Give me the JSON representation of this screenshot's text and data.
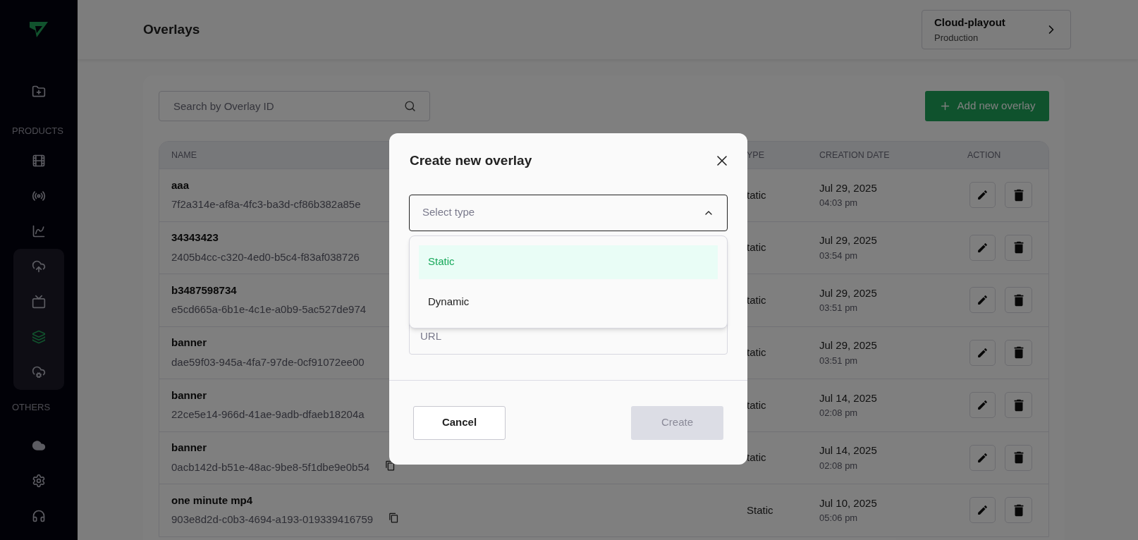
{
  "sidebar": {
    "top_items": [
      {
        "selected": false
      }
    ],
    "sections": [
      {
        "label": "PRODUCTS",
        "items": [
          {
            "selected": false
          },
          {
            "selected": false
          },
          {
            "selected": false
          }
        ],
        "group": [
          {
            "selected": false
          },
          {
            "selected": false
          },
          {
            "selected": true
          },
          {
            "selected": false
          }
        ]
      },
      {
        "label": "OTHERS",
        "items": [
          {
            "selected": false
          },
          {
            "selected": false
          },
          {
            "selected": false
          }
        ]
      }
    ]
  },
  "header": {
    "title": "Overlays",
    "workspace": {
      "name": "Cloud-playout",
      "environment": "Production"
    }
  },
  "toolbar": {
    "search": {
      "placeholder": "Search by Overlay ID"
    },
    "add_button": "Add new overlay"
  },
  "table": {
    "columns": [
      "NAME",
      "YPE",
      "CREATION DATE",
      "ACTION"
    ],
    "rows": [
      {
        "name": "aaa",
        "id": "7f2a314e-af8a-4fc3-ba3d-cf86b382a85e",
        "copyable": false,
        "type": "tatic",
        "date": "Jul 29, 2025",
        "time": "04:03 pm"
      },
      {
        "name": "34343423",
        "id": "2405b4cc-c320-4ed0-b5c4-f83af038726",
        "copyable": false,
        "type": "tatic",
        "date": "Jul 29, 2025",
        "time": "03:54 pm"
      },
      {
        "name": "b3487598734",
        "id": "e5cd665a-6b1e-4c1e-a0b9-5ac527de974",
        "copyable": false,
        "type": "tatic",
        "date": "Jul 29, 2025",
        "time": "03:51 pm"
      },
      {
        "name": "banner",
        "id": "dae59f03-945a-4fa7-97de-0cf91072ee00",
        "copyable": false,
        "type": "tatic",
        "date": "Jul 29, 2025",
        "time": "03:51 pm"
      },
      {
        "name": "banner",
        "id": "22ce5e14-966d-41ae-9adb-dfaeb18204a",
        "copyable": false,
        "type": "tatic",
        "date": "Jul 14, 2025",
        "time": "02:08 pm"
      },
      {
        "name": "banner",
        "id": "0acb142d-b51e-48ac-9be8-5f1dbe9e0b54",
        "copyable": true,
        "type": "tatic",
        "date": "Jul 14, 2025",
        "time": "02:08 pm"
      },
      {
        "name": "one minute mp4",
        "id": "903e8d2d-c0b3-4694-a193-019339416759",
        "copyable": true,
        "type": "Static",
        "date": "Jul 10, 2025",
        "time": "05:06 pm"
      }
    ]
  },
  "dialog": {
    "title": "Create new overlay",
    "select": {
      "placeholder": "Select type",
      "expanded": true,
      "options": [
        {
          "label": "Static",
          "selected": true
        },
        {
          "label": "Dynamic",
          "selected": false
        }
      ]
    },
    "url": {
      "placeholder": "URL"
    },
    "buttons": [
      {
        "label": "Cancel",
        "kind": "secondary",
        "disabled": false
      },
      {
        "label": "Create",
        "kind": "primary",
        "disabled": true
      }
    ]
  }
}
